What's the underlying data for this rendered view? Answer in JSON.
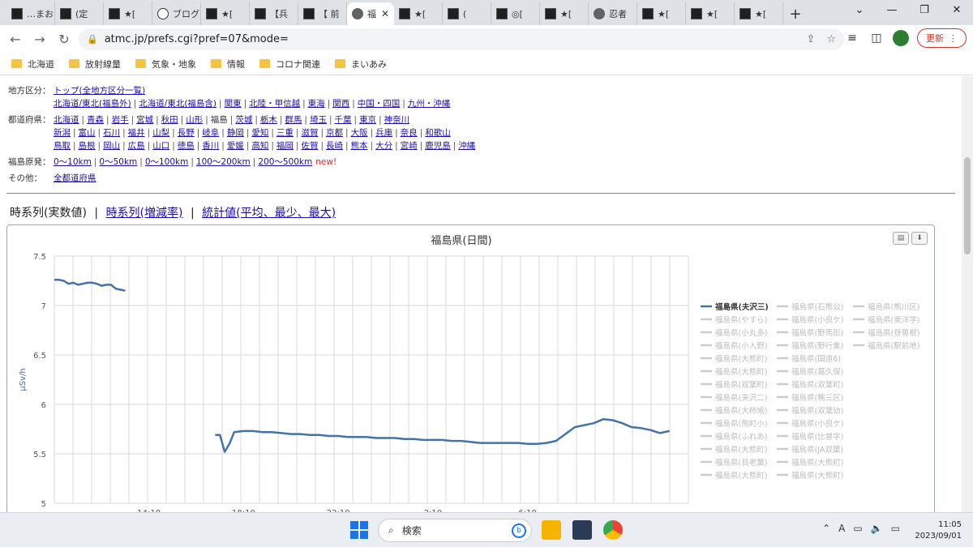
{
  "browser": {
    "tabs": [
      {
        "title": "…まお",
        "favicon": "site-icon"
      },
      {
        "title": "(定",
        "favicon": "site-icon"
      },
      {
        "title": "★[",
        "favicon": "site-icon"
      },
      {
        "title": "ブログ",
        "favicon": "info-circle-icon"
      },
      {
        "title": "★[",
        "favicon": "site-icon"
      },
      {
        "title": "【兵",
        "favicon": "site-icon"
      },
      {
        "title": "【 前",
        "favicon": "site-icon"
      },
      {
        "title": "福",
        "favicon": "globe-icon",
        "active": true
      },
      {
        "title": "★[",
        "favicon": "site-icon"
      },
      {
        "title": "(",
        "favicon": "site-icon"
      },
      {
        "title": "◎[",
        "favicon": "site-icon"
      },
      {
        "title": "★[",
        "favicon": "site-icon"
      },
      {
        "title": "忍者",
        "favicon": "globe-icon"
      },
      {
        "title": "★[",
        "favicon": "site-icon"
      },
      {
        "title": "★[",
        "favicon": "site-icon"
      },
      {
        "title": "★[",
        "favicon": "site-icon"
      }
    ],
    "url": "atmc.jp/prefs.cgi?pref=07&mode=",
    "update_label": "更新",
    "bookmarks": [
      "北海道",
      "放射線量",
      "気象・地象",
      "情報",
      "コロナ関連",
      "まいあみ"
    ]
  },
  "page": {
    "region_label": "地方区分：",
    "region_top": "トップ(全地方区分一覧)",
    "region_links": [
      "北海道/東北(福島外)",
      "北海道/東北(福島含)",
      "関東",
      "北陸・甲信越",
      "東海",
      "関西",
      "中国・四国",
      "九州・沖縄"
    ],
    "pref_label": "都道府県：",
    "pref_row1": [
      "北海道",
      "青森",
      "岩手",
      "宮城",
      "秋田",
      "山形",
      "福島",
      "茨城",
      "栃木",
      "群馬",
      "埼玉",
      "千葉",
      "東京",
      "神奈川"
    ],
    "pref_row2": [
      "新潟",
      "富山",
      "石川",
      "福井",
      "山梨",
      "長野",
      "岐阜",
      "静岡",
      "愛知",
      "三重",
      "滋賀",
      "京都",
      "大阪",
      "兵庫",
      "奈良",
      "和歌山"
    ],
    "pref_row3": [
      "鳥取",
      "島根",
      "岡山",
      "広島",
      "山口",
      "徳島",
      "香川",
      "愛媛",
      "高知",
      "福岡",
      "佐賀",
      "長崎",
      "熊本",
      "大分",
      "宮崎",
      "鹿児島",
      "沖縄"
    ],
    "current_pref": "福島",
    "genpatsu_label": "福島原発：",
    "genpatsu_links": [
      "0〜10km",
      "0〜50km",
      "0〜100km",
      "100〜200km",
      "200〜500km"
    ],
    "new_label": "new!",
    "other_label": "その他：",
    "other_link": "全都道府県",
    "view_current": "時系列(実数値)",
    "view_links": [
      "時系列(増減率)",
      "統計値(平均、最少、最大)"
    ]
  },
  "chart_data": {
    "type": "line",
    "title": "福島県(日間)",
    "ylabel": "μSv/h",
    "ylim": [
      5,
      7.5
    ],
    "yticks": [
      5,
      5.5,
      6,
      6.5,
      7,
      7.5
    ],
    "xtick_labels": [
      "14:10",
      "18:10",
      "22:10",
      "2:10",
      "6:10"
    ],
    "series": [
      {
        "name": "福島県(夫沢三)",
        "color": "#4572a7",
        "segments": [
          {
            "x": [
              0,
              0.5,
              1,
              1.5,
              2,
              2.5,
              3,
              3.5,
              4,
              4.5,
              5,
              5.5,
              6,
              6.5,
              7,
              7.5
            ],
            "y": [
              7.26,
              7.26,
              7.25,
              7.22,
              7.23,
              7.21,
              7.22,
              7.23,
              7.23,
              7.22,
              7.2,
              7.21,
              7.21,
              7.17,
              7.16,
              7.15
            ]
          },
          {
            "x": [
              17,
              17.5,
              18,
              18.5,
              19,
              20,
              21,
              22,
              23,
              24,
              25,
              26,
              27,
              28,
              29,
              30,
              31,
              32,
              33,
              34,
              35,
              36,
              37,
              38,
              39,
              40,
              41,
              42,
              43,
              44,
              45,
              46,
              47,
              48,
              49,
              50,
              51,
              52,
              53,
              54,
              55,
              56,
              57,
              58,
              59,
              60,
              61,
              62,
              63,
              64,
              65
            ],
            "y": [
              5.69,
              5.69,
              5.52,
              5.6,
              5.72,
              5.73,
              5.73,
              5.72,
              5.72,
              5.71,
              5.7,
              5.7,
              5.69,
              5.69,
              5.68,
              5.68,
              5.67,
              5.67,
              5.67,
              5.66,
              5.66,
              5.66,
              5.65,
              5.65,
              5.64,
              5.64,
              5.64,
              5.63,
              5.63,
              5.62,
              5.61,
              5.61,
              5.61,
              5.61,
              5.61,
              5.6,
              5.6,
              5.61,
              5.63,
              5.7,
              5.77,
              5.79,
              5.81,
              5.85,
              5.84,
              5.81,
              5.77,
              5.76,
              5.74,
              5.71,
              5.73
            ]
          }
        ]
      }
    ],
    "legend": {
      "placement": "right",
      "entries": [
        "福島県(夫沢三)",
        "福島県(石熊公)",
        "福島県(熊川区)",
        "福島県(やすら)",
        "福島県(小良ケ)",
        "福島県(東洋学)",
        "福島県(小丸多)",
        "福島県(野馬形)",
        "福島県(昼曽根)",
        "福島県(小入野)",
        "福島県(野行集)",
        "福島県(駅前地)",
        "福島県(大熊町)",
        "福島県(国道6)",
        "福島県(大熊町)",
        "福島県(葛久保)",
        "福島県(双葉町)",
        "福島県(双葉町)",
        "福島県(夫沢二)",
        "福島県(鴨三区)",
        "福島県(大柿鳩)",
        "福島県(双葉幼)",
        "福島県(熊町小)",
        "福島県(小良ケ)",
        "福島県(ふれあ)",
        "福島県(比曽字)",
        "福島県(大熊町)",
        "福島県(JA双葉)",
        "福島県(貝老葉)",
        "福島県(大熊町)",
        "福島県(大熊町)",
        "福島県(大熊町)"
      ]
    },
    "grid": true
  },
  "taskbar": {
    "search_placeholder": "検索",
    "time": "11:05",
    "date": "2023/09/01",
    "ime": "A"
  }
}
